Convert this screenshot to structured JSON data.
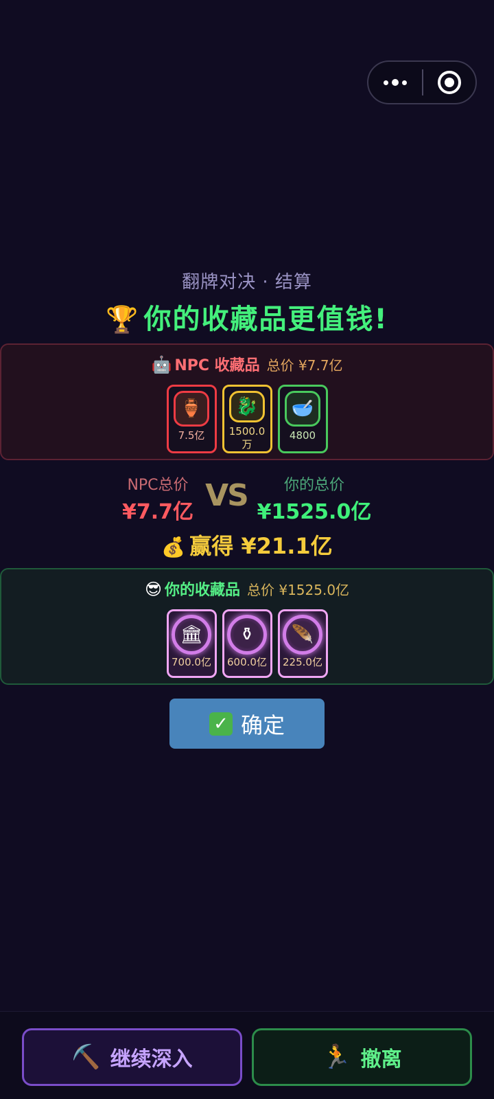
{
  "capsule": {
    "more_icon": "more-dots-icon",
    "close_icon": "target-circle-icon"
  },
  "header": {
    "subtitle": "翻牌对决 · 结算",
    "headline": "你的收藏品更值钱!",
    "headline_icon": "🏆"
  },
  "npc_panel": {
    "icon": "🤖",
    "title": "NPC 收藏品",
    "total": "总价 ¥7.7亿",
    "cards": [
      {
        "icon": "🏺",
        "value": "7.5亿",
        "rarity": "red"
      },
      {
        "icon": "🐉",
        "value": "1500.0万",
        "rarity": "gold"
      },
      {
        "icon": "🥣",
        "value": "4800",
        "rarity": "green"
      }
    ]
  },
  "compare": {
    "npc_label": "NPC总价",
    "npc_value": "¥7.7亿",
    "vs": "VS",
    "you_label": "你的总价",
    "you_value": "¥1525.0亿",
    "win_icon": "💰",
    "win_text": "赢得 ¥21.1亿"
  },
  "your_panel": {
    "icon": "😎",
    "title": "你的收藏品",
    "total": "总价 ¥1525.0亿",
    "cards": [
      {
        "icon": "🏛",
        "value": "700.0亿",
        "rarity": "purple"
      },
      {
        "icon": "⚱",
        "value": "600.0亿",
        "rarity": "purple"
      },
      {
        "icon": "🪶",
        "value": "225.0亿",
        "rarity": "purple"
      }
    ]
  },
  "confirm": {
    "icon": "✓",
    "label": "确定"
  },
  "bottom": {
    "continue_icon": "⛏️",
    "continue_label": "继续深入",
    "leave_icon": "🏃",
    "leave_label": "撤离"
  },
  "colors": {
    "background": "#100c22",
    "win_green": "#44f07c",
    "npc_red": "#ff5a60",
    "gold": "#f5cc3c",
    "confirm_blue": "#4884bb"
  }
}
